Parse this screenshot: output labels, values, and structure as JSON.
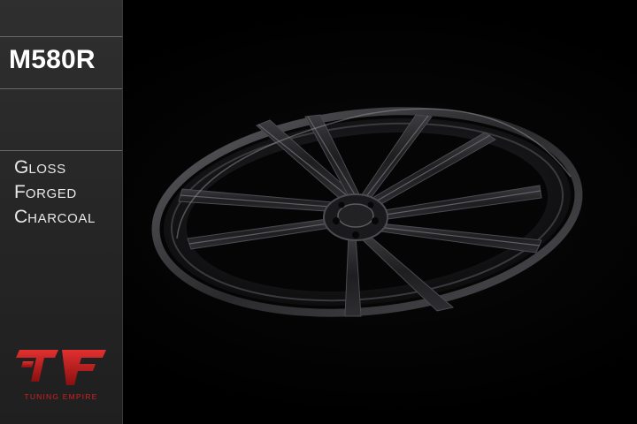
{
  "product": {
    "model": "M580R",
    "finish_lines": [
      {
        "initial": "G",
        "rest": "loss"
      },
      {
        "initial": "F",
        "rest": "orged"
      },
      {
        "initial": "C",
        "rest": "harcoal"
      }
    ]
  },
  "brand": {
    "logo_caption": "TUNING EMPIRE",
    "logo_color": "#c81e1e"
  },
  "image": {
    "subject": "wheel-image",
    "wheel_color": "#1c1c1e"
  }
}
